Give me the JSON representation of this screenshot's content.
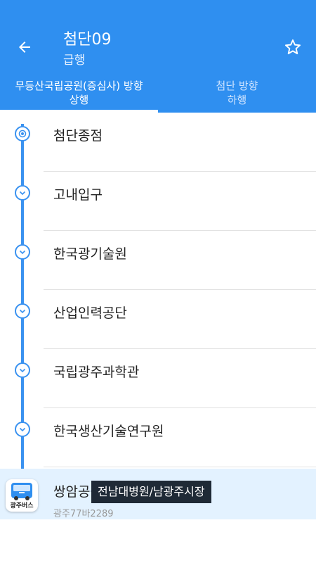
{
  "header": {
    "title": "첨단09",
    "subtitle": "급행"
  },
  "icons": {
    "back": "arrow-left-icon",
    "favorite": "star-outline-icon",
    "bus": "bus-icon"
  },
  "colors": {
    "primary": "#2f8ff0",
    "rail": "#3a92f0",
    "current_row": "#e3f2ff",
    "tooltip_bg": "#1f2a36"
  },
  "tabs": [
    {
      "line1": "무등산국립공원(증심사) 방향",
      "line2": "상행",
      "active": true
    },
    {
      "line1": "첨단 방향",
      "line2": "하행",
      "active": false
    }
  ],
  "stops": [
    {
      "name": "첨단종점",
      "marker": "origin"
    },
    {
      "name": "고내입구",
      "marker": "chevron"
    },
    {
      "name": "한국광기술원",
      "marker": "chevron"
    },
    {
      "name": "산업인력공단",
      "marker": "chevron"
    },
    {
      "name": "국립광주과학관",
      "marker": "chevron"
    },
    {
      "name": "한국생산기술연구원",
      "marker": "chevron"
    }
  ],
  "current_stop": {
    "name": "쌍암공원",
    "plate": "광주77바2289",
    "bus_label": "광주버스",
    "tooltip": "전남대병원/남광주시장"
  }
}
